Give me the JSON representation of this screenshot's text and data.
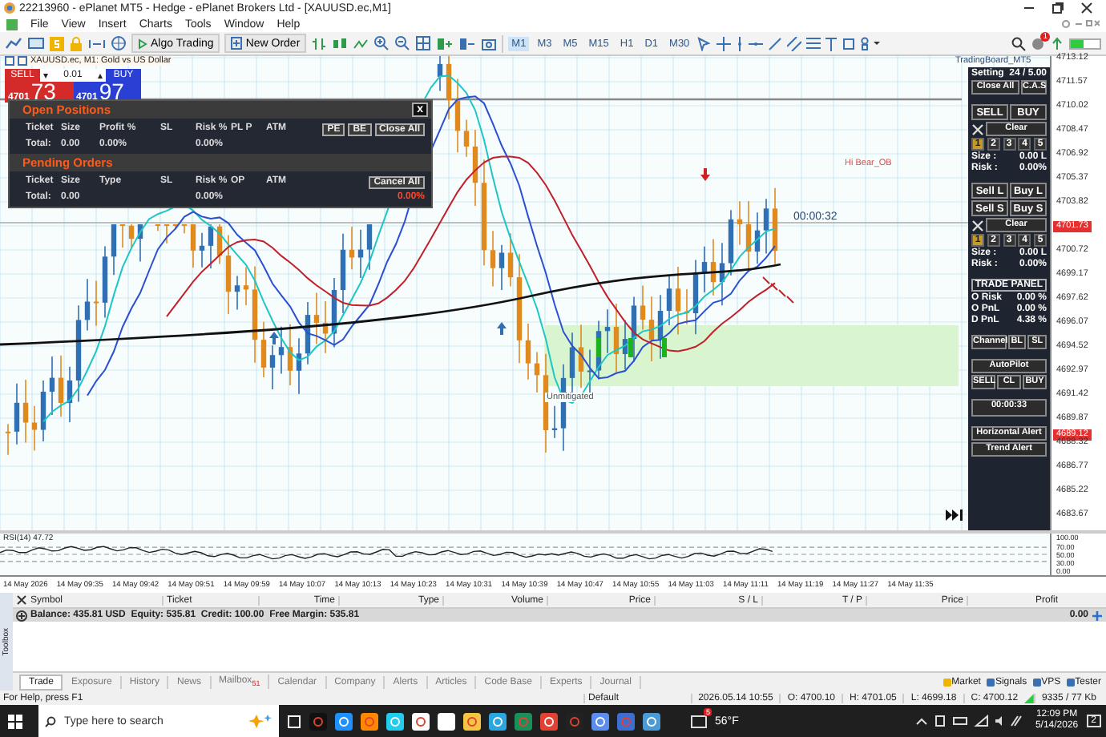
{
  "window": {
    "title": "22213960 - ePlanet MT5 - Hedge - ePlanet Brokers Ltd - [XAUUSD.ec,M1]"
  },
  "menu": [
    "File",
    "View",
    "Insert",
    "Charts",
    "Tools",
    "Window",
    "Help"
  ],
  "toolbar": {
    "algo_trading": "Algo Trading",
    "new_order": "New Order",
    "notification_count": "1",
    "timeframes": [
      {
        "label": "M1",
        "selected": true
      },
      {
        "label": "M3",
        "selected": false
      },
      {
        "label": "M5",
        "selected": false
      },
      {
        "label": "M15",
        "selected": false
      },
      {
        "label": "H1",
        "selected": false
      },
      {
        "label": "D1",
        "selected": false
      },
      {
        "label": "M30",
        "selected": false
      }
    ]
  },
  "chart": {
    "title": "XAUUSD.ec, M1: Gold vs US Dollar",
    "board_label": "TradingBoard_MT5",
    "zone_label": "Hi Bear_OB",
    "unmitigated_label": "Unmitigated",
    "countdown": "00:00:32",
    "one_click": {
      "sell": "SELL",
      "buy": "BUY",
      "lot": "0.01",
      "lot_down": "▾",
      "lot_up": "▴",
      "bid_big_figure": "4701",
      "bid_pips": "73",
      "ask_big_figure": "4701",
      "ask_pips": "97"
    },
    "price_axis": [
      {
        "text": "4713.12",
        "kind": "label"
      },
      {
        "text": "4711.57",
        "kind": "label"
      },
      {
        "text": "4710.02",
        "kind": "label"
      },
      {
        "text": "4708.47",
        "kind": "label"
      },
      {
        "text": "4706.92",
        "kind": "label"
      },
      {
        "text": "4705.37",
        "kind": "label"
      },
      {
        "text": "4703.82",
        "kind": "label"
      },
      {
        "text": "4701.73",
        "kind": "tag"
      },
      {
        "text": "4700.72",
        "kind": "label"
      },
      {
        "text": "4699.17",
        "kind": "label"
      },
      {
        "text": "4697.62",
        "kind": "label"
      },
      {
        "text": "4696.07",
        "kind": "label"
      },
      {
        "text": "4694.52",
        "kind": "label"
      },
      {
        "text": "4692.97",
        "kind": "label"
      },
      {
        "text": "4691.42",
        "kind": "label"
      },
      {
        "text": "4689.87",
        "kind": "label"
      },
      {
        "text": "4689.12",
        "kind": "tag_between"
      },
      {
        "text": "4688.32",
        "kind": "label"
      },
      {
        "text": "4686.77",
        "kind": "label"
      },
      {
        "text": "4685.22",
        "kind": "label"
      },
      {
        "text": "4683.67",
        "kind": "label"
      }
    ]
  },
  "open_positions": {
    "title": "Open Positions",
    "close": "x",
    "headers": [
      "Ticket",
      "Size",
      "Profit %",
      "SL",
      "Risk %",
      "PL P",
      "ATM"
    ],
    "buttons": [
      "PE",
      "BE",
      "Close All"
    ],
    "total": {
      "label": "Total:",
      "size": "0.00",
      "profit": "0.00%",
      "risk": "0.00%"
    }
  },
  "pending_orders": {
    "title": "Pending Orders",
    "headers": [
      "Ticket",
      "Size",
      "Type",
      "SL",
      "Risk %",
      "OP",
      "ATM"
    ],
    "button": "Cancel All",
    "total": {
      "label": "Total:",
      "size": "0.00",
      "risk": "0.00%",
      "result": "0.00%"
    }
  },
  "trade_panel": {
    "setting": "Setting",
    "setting_value": "24 / 5.00",
    "close_all": "Close All",
    "cas": "C.A.S",
    "market": {
      "buttons": [
        [
          "SELL",
          "BUY"
        ]
      ],
      "clear": "Clear",
      "presets": [
        {
          "label": "1",
          "selected": true
        },
        {
          "label": "2",
          "selected": false
        },
        {
          "label": "3",
          "selected": false
        },
        {
          "label": "4",
          "selected": false
        },
        {
          "label": "5",
          "selected": false
        }
      ],
      "size_label": "Size :",
      "size": "0.00 L",
      "risk_label": "Risk :",
      "risk": "0.00%"
    },
    "pending": {
      "buttons": [
        [
          "Sell L",
          "Buy L"
        ],
        [
          "Sell S",
          "Buy S"
        ]
      ],
      "clear": "Clear",
      "presets": [
        {
          "label": "1",
          "selected": true
        },
        {
          "label": "2",
          "selected": false
        },
        {
          "label": "3",
          "selected": false
        },
        {
          "label": "4",
          "selected": false
        },
        {
          "label": "5",
          "selected": false
        }
      ],
      "size_label": "Size :",
      "size": "0.00 L",
      "risk_label": "Risk :",
      "risk": "0.00%"
    },
    "stats_title": "TRADE PANEL",
    "stats": [
      {
        "label": "O Risk",
        "value": "0.00 %"
      },
      {
        "label": "O PnL",
        "value": "0.00 %"
      },
      {
        "label": "D PnL",
        "value": "4.38 %"
      }
    ],
    "channel": [
      "Channel",
      "BL",
      "SL"
    ],
    "autopilot": "AutoPilot",
    "autopilot_buttons": [
      "SELL",
      "CL",
      "BUY"
    ],
    "timer": "00:00:33",
    "alerts": [
      "Horizontal Alert",
      "Trend Alert"
    ]
  },
  "rsi": {
    "title": "RSI(14) 47.72",
    "axis": [
      "100.00",
      "70.00",
      "50.00",
      "30.00",
      "0.00"
    ]
  },
  "time_axis": [
    "14 May 2026",
    "14 May 09:35",
    "14 May 09:42",
    "14 May 09:51",
    "14 May 09:59",
    "14 May 10:07",
    "14 May 10:13",
    "14 May 10:23",
    "14 May 10:31",
    "14 May 10:39",
    "14 May 10:47",
    "14 May 10:55",
    "14 May 11:03",
    "14 May 11:11",
    "14 May 11:19",
    "14 May 11:27",
    "14 May 11:35"
  ],
  "toolbox": {
    "side_label": "Toolbox",
    "columns": [
      "Symbol",
      "Ticket",
      "Time",
      "Type",
      "Volume",
      "Price",
      "S / L",
      "T / P",
      "Price",
      "Profit"
    ],
    "balance": "Balance: 435.81 USD  Equity: 535.81  Credit: 100.00  Free Margin: 535.81",
    "profit_total": "0.00",
    "tabs": [
      {
        "label": "Trade",
        "selected": true
      },
      {
        "label": "Exposure",
        "selected": false
      },
      {
        "label": "History",
        "selected": false
      },
      {
        "label": "News",
        "selected": false
      },
      {
        "label": "Mailbox",
        "badge": "51",
        "selected": false
      },
      {
        "label": "Calendar",
        "selected": false
      },
      {
        "label": "Company",
        "selected": false
      },
      {
        "label": "Alerts",
        "selected": false
      },
      {
        "label": "Articles",
        "selected": false
      },
      {
        "label": "Code Base",
        "selected": false
      },
      {
        "label": "Experts",
        "selected": false
      },
      {
        "label": "Journal",
        "selected": false
      }
    ],
    "links": [
      "Market",
      "Signals",
      "VPS",
      "Tester"
    ]
  },
  "status_bar": {
    "help": "For Help, press F1",
    "profile": "Default",
    "time": "2026.05.14 10:55",
    "ohlc": [
      "O: 4700.10",
      "H: 4701.05",
      "L: 4699.18",
      "C: 4700.12"
    ],
    "traffic": "9335 / 77 Kb"
  },
  "taskbar": {
    "search_placeholder": "Type here to search",
    "weather_badge": "5",
    "temperature": "56°F",
    "time": "12:09 PM",
    "date": "5/14/2026",
    "notifications": "2"
  }
}
